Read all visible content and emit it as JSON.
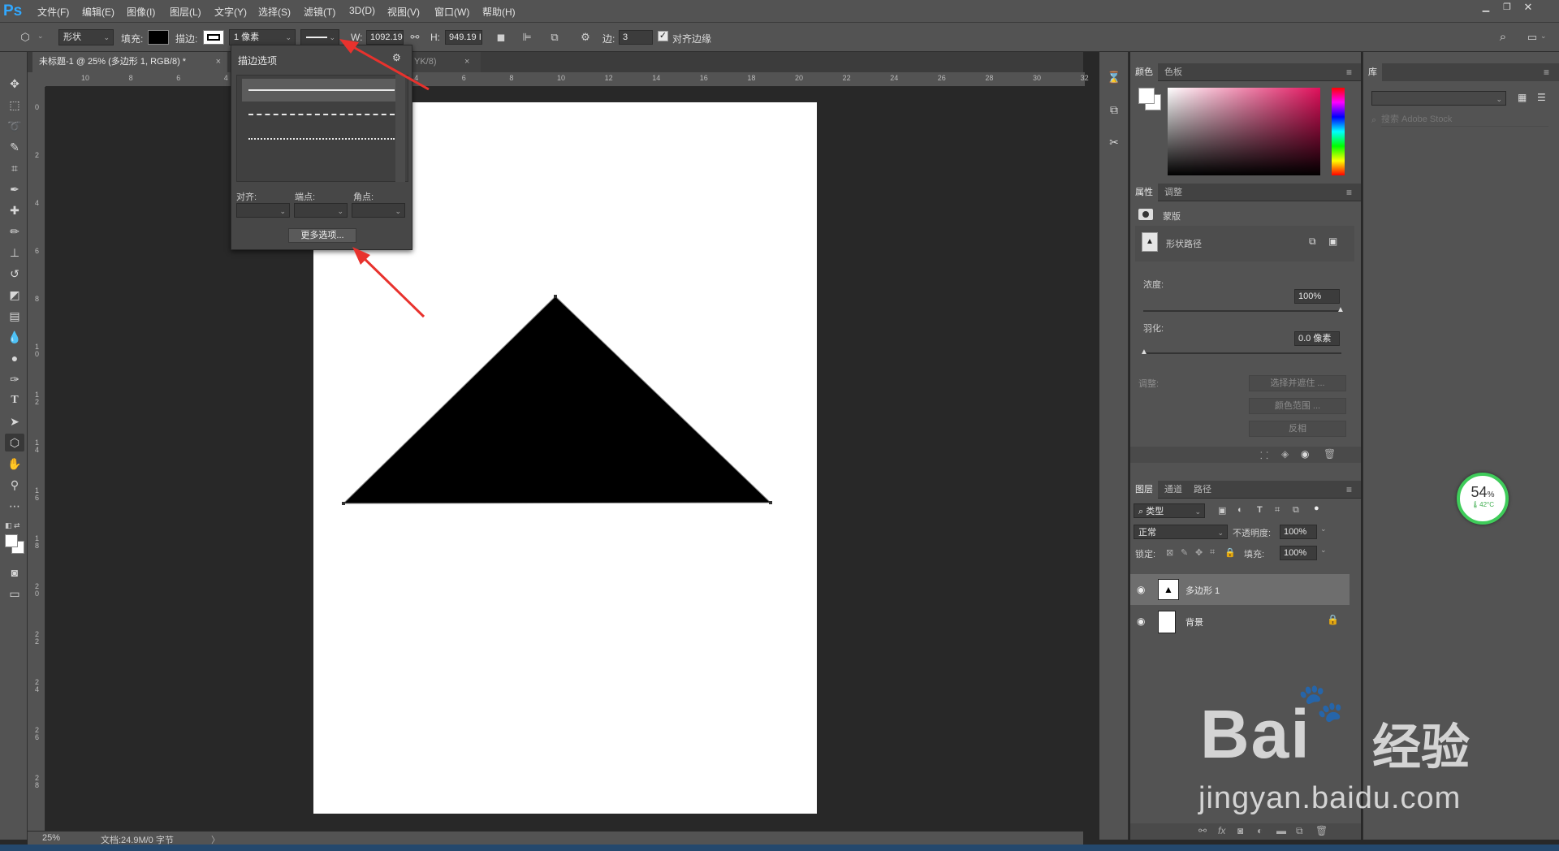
{
  "app": {
    "logo": "Ps"
  },
  "menu": [
    "文件(F)",
    "编辑(E)",
    "图像(I)",
    "图层(L)",
    "文字(Y)",
    "选择(S)",
    "滤镜(T)",
    "3D(D)",
    "视图(V)",
    "窗口(W)",
    "帮助(H)"
  ],
  "options": {
    "shape_mode": "形状",
    "fill_label": "填充:",
    "stroke_label": "描边:",
    "stroke_width": "1 像素",
    "w_label": "W:",
    "w_value": "1092.19",
    "h_label": "H:",
    "h_value": "949.19 I",
    "sides_label": "边:",
    "sides_value": "3",
    "align_edges_label": "对齐边缘",
    "align_edges_checked": true
  },
  "stroke_popup": {
    "title": "描边选项",
    "align_label": "对齐:",
    "caps_label": "端点:",
    "corners_label": "角点:",
    "more_button": "更多选项..."
  },
  "document": {
    "tab_active": "未标题-1 @ 25% (多边形 1, RGB/8) *",
    "tab_inactive": "YK/8)",
    "ruler_top": [
      "10",
      "8",
      "6",
      "4",
      "2",
      "0",
      "2",
      "4",
      "6",
      "8",
      "10",
      "12",
      "14",
      "16",
      "18",
      "20",
      "22",
      "24",
      "26",
      "28",
      "30",
      "32"
    ],
    "ruler_left": [
      "0",
      "2",
      "4",
      "6",
      "8",
      "1 0",
      "1 2",
      "1 4",
      "1 6",
      "1 8",
      "2 0",
      "2 2",
      "2 4",
      "2 6",
      "2 8"
    ]
  },
  "status": {
    "zoom": "25%",
    "doc_info": "文档:24.9M/0 字节",
    "arrow": "〉"
  },
  "color_panel": {
    "tabs": [
      "颜色",
      "色板"
    ]
  },
  "properties_panel": {
    "tabs": [
      "属性",
      "调整"
    ],
    "mask_label": "蒙版",
    "shape_path_label": "形状路径",
    "density_label": "浓度:",
    "density_value": "100%",
    "feather_label": "羽化:",
    "feather_value": "0.0 像素",
    "adjust_label": "调整:",
    "btn_select_mask": "选择并遮住 ...",
    "btn_color_range": "颜色范围 ...",
    "btn_invert": "反相"
  },
  "layers_panel": {
    "tabs": [
      "图层",
      "通道",
      "路径"
    ],
    "filter_kind": "类型",
    "blend_mode": "正常",
    "opacity_label": "不透明度:",
    "opacity_value": "100%",
    "lock_label": "锁定:",
    "fill_label": "填充:",
    "fill_value": "100%",
    "layers": [
      {
        "name": "多边形 1",
        "selected": true
      },
      {
        "name": "背景",
        "selected": false
      }
    ]
  },
  "library_panel": {
    "tab": "库",
    "search_placeholder": "搜索 Adobe Stock"
  },
  "overlay": {
    "battery_percent": "54",
    "battery_unit": "%",
    "temperature": "42°C"
  },
  "watermark": {
    "brand": "Bai",
    "brand_cn": "经验",
    "site": "jingyan.baidu.com"
  },
  "colors": {
    "accent": "#31a8ff",
    "panel_bg": "#535353",
    "canvas_bg": "#282828",
    "arrow_red": "#e8322d"
  }
}
